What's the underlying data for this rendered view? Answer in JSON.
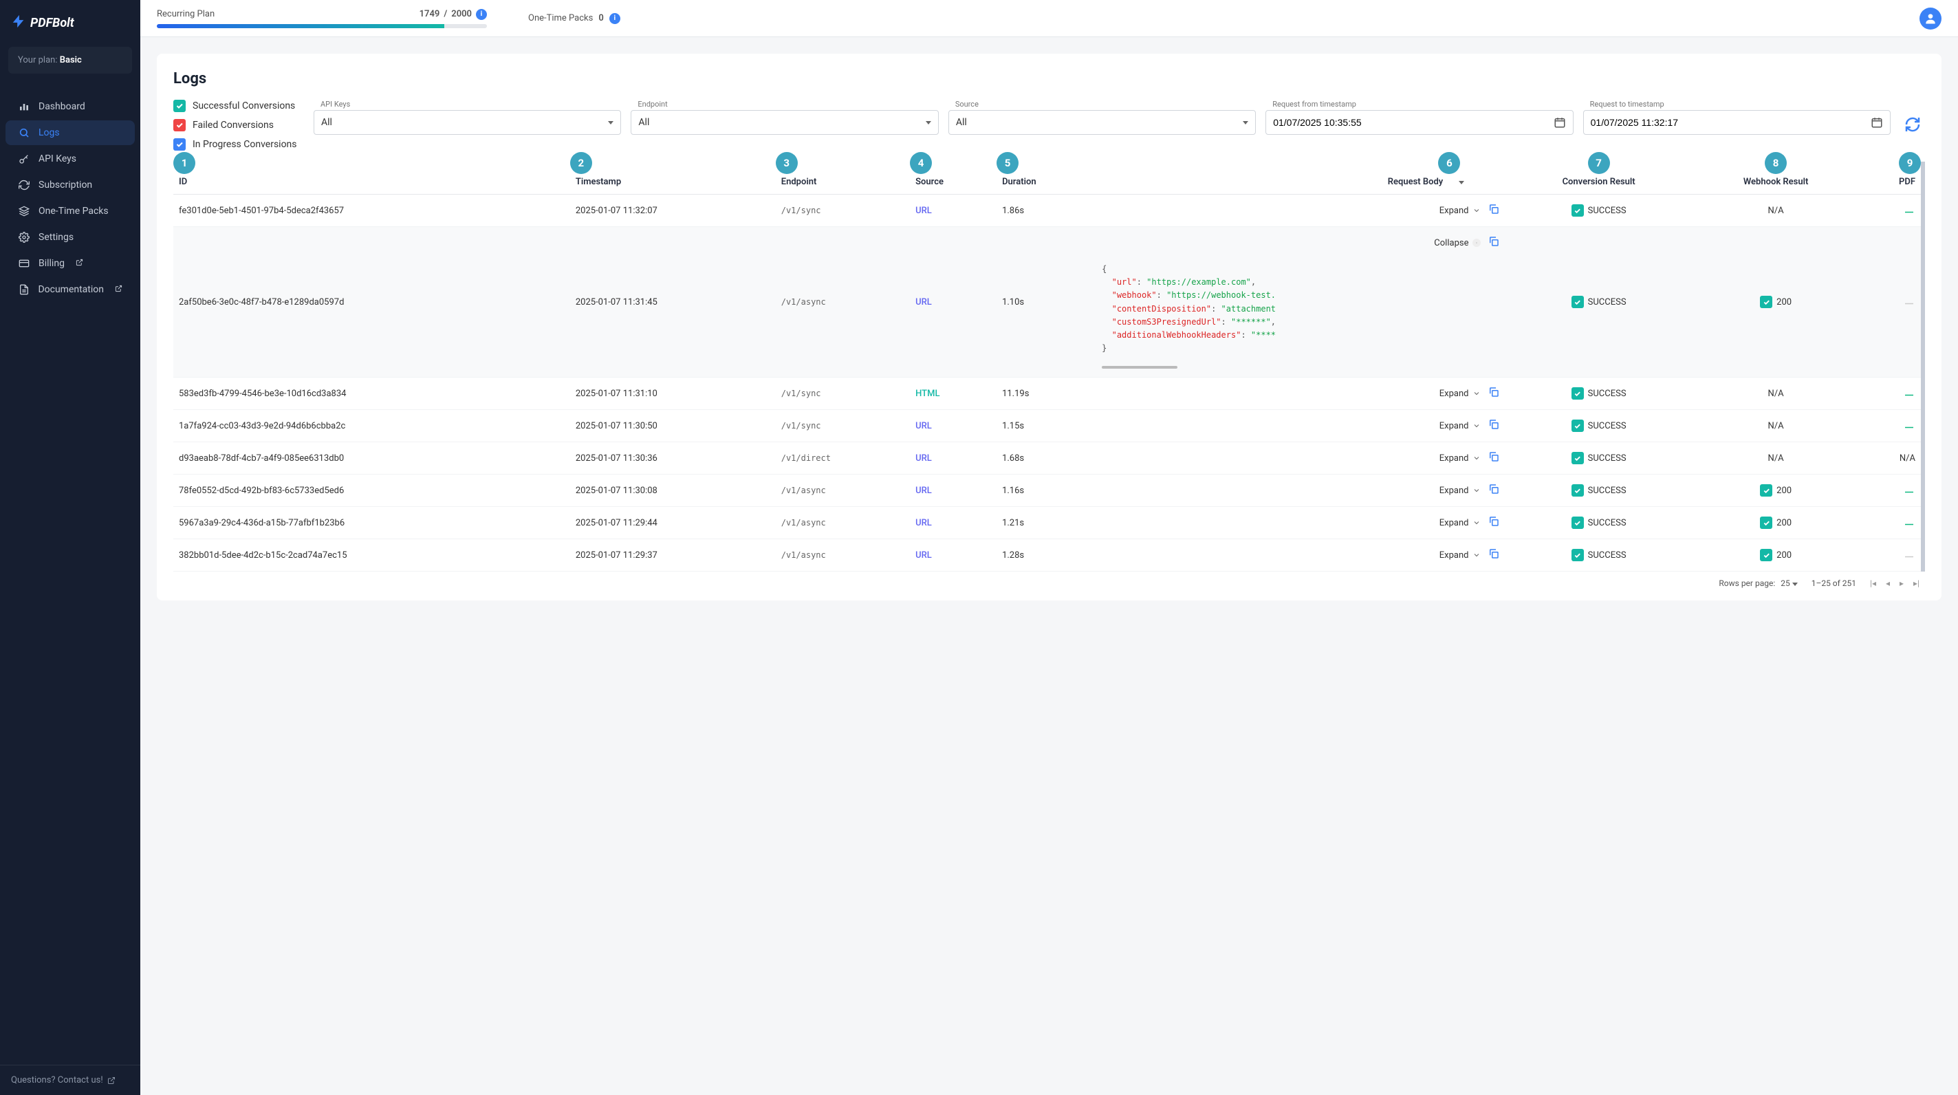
{
  "brand": {
    "name": "PDFBolt"
  },
  "plan_box": {
    "label": "Your plan:",
    "value": "Basic"
  },
  "sidebar": {
    "items": [
      {
        "label": "Dashboard",
        "icon": "bar-chart-icon"
      },
      {
        "label": "Logs",
        "icon": "search-icon",
        "active": true
      },
      {
        "label": "API Keys",
        "icon": "key-icon"
      },
      {
        "label": "Subscription",
        "icon": "refresh-icon"
      },
      {
        "label": "One-Time Packs",
        "icon": "layers-icon"
      },
      {
        "label": "Settings",
        "icon": "gear-icon"
      },
      {
        "label": "Billing",
        "icon": "card-icon",
        "external": true
      },
      {
        "label": "Documentation",
        "icon": "doc-icon",
        "external": true
      }
    ],
    "footer": "Questions? Contact us!"
  },
  "topbar": {
    "recurring_label": "Recurring Plan",
    "recurring_used": "1749",
    "recurring_total": "2000",
    "onetime_label": "One-Time Packs",
    "onetime_count": "0"
  },
  "page": {
    "title": "Logs"
  },
  "filters": {
    "checkboxes": [
      {
        "label": "Successful Conversions",
        "color": "teal"
      },
      {
        "label": "Failed Conversions",
        "color": "red"
      },
      {
        "label": "In Progress Conversions",
        "color": "blue"
      }
    ],
    "api_keys": {
      "label": "API Keys",
      "value": "All"
    },
    "endpoint": {
      "label": "Endpoint",
      "value": "All"
    },
    "source": {
      "label": "Source",
      "value": "All"
    },
    "from": {
      "label": "Request from timestamp",
      "value": "01/07/2025 10:35:55"
    },
    "to": {
      "label": "Request to timestamp",
      "value": "01/07/2025 11:32:17"
    }
  },
  "table": {
    "headers": [
      "ID",
      "Timestamp",
      "Endpoint",
      "Source",
      "Duration",
      "Request Body",
      "Conversion Result",
      "Webhook Result",
      "PDF"
    ],
    "badges": [
      "1",
      "2",
      "3",
      "4",
      "5",
      "6",
      "7",
      "8",
      "9"
    ],
    "expand_label": "Expand",
    "collapse_label": "Collapse",
    "rows": [
      {
        "id": "fe301d0e-5eb1-4501-97b4-5deca2f43657",
        "ts": "2025-01-07 11:32:07",
        "endpoint": "/v1/sync",
        "source": "URL",
        "duration": "1.86s",
        "conv": "SUCCESS",
        "webhook": "N/A",
        "pdf": true
      },
      {
        "id": "2af50be6-3e0c-48f7-b478-e1289da0597d",
        "ts": "2025-01-07 11:31:45",
        "endpoint": "/v1/async",
        "source": "URL",
        "duration": "1.10s",
        "conv": "SUCCESS",
        "webhook": "200",
        "webhook_check": true,
        "pdf": false,
        "expanded": true
      },
      {
        "id": "583ed3fb-4799-4546-be3e-10d16cd3a834",
        "ts": "2025-01-07 11:31:10",
        "endpoint": "/v1/sync",
        "source": "HTML",
        "duration": "11.19s",
        "conv": "SUCCESS",
        "webhook": "N/A",
        "pdf": true
      },
      {
        "id": "1a7fa924-cc03-43d3-9e2d-94d6b6cbba2c",
        "ts": "2025-01-07 11:30:50",
        "endpoint": "/v1/sync",
        "source": "URL",
        "duration": "1.15s",
        "conv": "SUCCESS",
        "webhook": "N/A",
        "pdf": true
      },
      {
        "id": "d93aeab8-78df-4cb7-a4f9-085ee6313db0",
        "ts": "2025-01-07 11:30:36",
        "endpoint": "/v1/direct",
        "source": "URL",
        "duration": "1.68s",
        "conv": "SUCCESS",
        "webhook": "N/A",
        "pdf_na": true
      },
      {
        "id": "78fe0552-d5cd-492b-bf83-6c5733ed5ed6",
        "ts": "2025-01-07 11:30:08",
        "endpoint": "/v1/async",
        "source": "URL",
        "duration": "1.16s",
        "conv": "SUCCESS",
        "webhook": "200",
        "webhook_check": true,
        "pdf": true
      },
      {
        "id": "5967a3a9-29c4-436d-a15b-77afbf1b23b6",
        "ts": "2025-01-07 11:29:44",
        "endpoint": "/v1/async",
        "source": "URL",
        "duration": "1.21s",
        "conv": "SUCCESS",
        "webhook": "200",
        "webhook_check": true,
        "pdf": true
      },
      {
        "id": "382bb01d-5dee-4d2c-b15c-2cad74a7ec15",
        "ts": "2025-01-07 11:29:37",
        "endpoint": "/v1/async",
        "source": "URL",
        "duration": "1.28s",
        "conv": "SUCCESS",
        "webhook": "200",
        "webhook_check": true,
        "pdf": false
      }
    ],
    "expanded_body": {
      "url": "https://example.com",
      "webhook": "https://webhook-test.",
      "contentDisposition": "attachment",
      "customS3PresignedUrl": "******",
      "additionalWebhookHeaders": "****"
    }
  },
  "pagination": {
    "rows_per_page_label": "Rows per page:",
    "rows_per_page": "25",
    "range": "1–25 of 251"
  }
}
